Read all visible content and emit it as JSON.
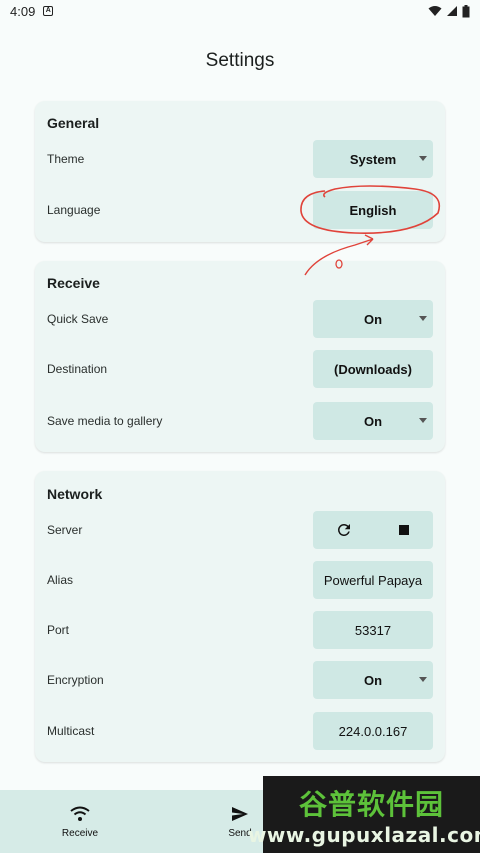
{
  "status_bar": {
    "time": "4:09",
    "app_badge": "A"
  },
  "page_title": "Settings",
  "general": {
    "title": "General",
    "theme": {
      "label": "Theme",
      "value": "System"
    },
    "language": {
      "label": "Language",
      "value": "English"
    }
  },
  "receive": {
    "title": "Receive",
    "quick_save": {
      "label": "Quick Save",
      "value": "On"
    },
    "destination": {
      "label": "Destination",
      "value": "(Downloads)"
    },
    "save_media": {
      "label": "Save media to gallery",
      "value": "On"
    }
  },
  "network": {
    "title": "Network",
    "server": {
      "label": "Server"
    },
    "alias": {
      "label": "Alias",
      "value": "Powerful Papaya"
    },
    "port": {
      "label": "Port",
      "value": "53317"
    },
    "encryption": {
      "label": "Encryption",
      "value": "On"
    },
    "multicast": {
      "label": "Multicast",
      "value": "224.0.0.167"
    }
  },
  "bottom_nav": {
    "receive": "Receive",
    "send": "Send"
  },
  "watermark": {
    "brand": "谷普软件园",
    "url": "www.gupuxlazal.com"
  },
  "colors": {
    "card": "#edf6f4",
    "control": "#cfe8e4",
    "nav": "#d6ebe7",
    "annotation": "#e0433a"
  },
  "icons": {
    "wifi": "wifi-icon",
    "send": "send-icon",
    "refresh": "refresh-icon",
    "stop": "stop-icon"
  }
}
